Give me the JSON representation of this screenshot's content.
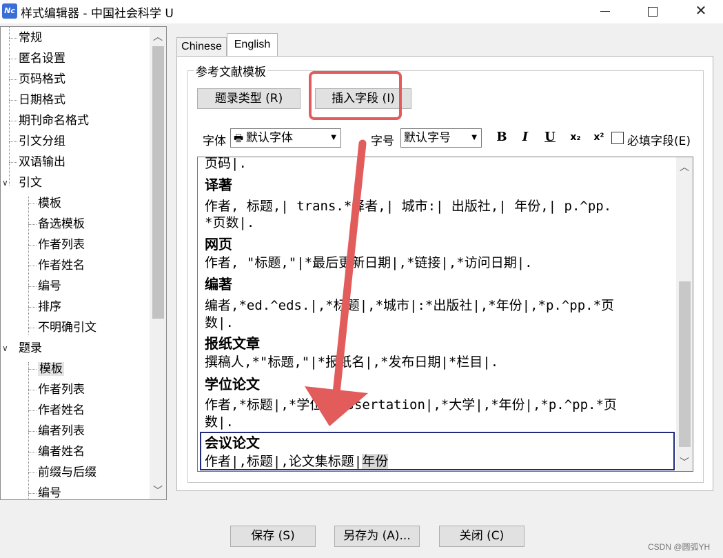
{
  "window": {
    "icon_text": "Nc",
    "title": "样式编辑器 - 中国社会科学 U",
    "minimize": "minimize",
    "maximize": "maximize",
    "close": "close"
  },
  "tree": {
    "items": [
      {
        "label": "常规"
      },
      {
        "label": "匿名设置"
      },
      {
        "label": "页码格式"
      },
      {
        "label": "日期格式"
      },
      {
        "label": "期刊命名格式"
      },
      {
        "label": "引文分组"
      },
      {
        "label": "双语输出"
      },
      {
        "label": "引文",
        "expander": "∨"
      },
      {
        "label": "模板"
      },
      {
        "label": "备选模板"
      },
      {
        "label": "作者列表"
      },
      {
        "label": "作者姓名"
      },
      {
        "label": "编号"
      },
      {
        "label": "排序"
      },
      {
        "label": "不明确引文"
      },
      {
        "label": "题录",
        "expander": "∨"
      },
      {
        "label": "模板",
        "selected": true
      },
      {
        "label": "作者列表"
      },
      {
        "label": "作者姓名"
      },
      {
        "label": "编者列表"
      },
      {
        "label": "编者姓名"
      },
      {
        "label": "前缀与后缀"
      },
      {
        "label": "编号"
      }
    ]
  },
  "tabs": [
    {
      "label": "Chinese",
      "active": false
    },
    {
      "label": "English",
      "active": true
    }
  ],
  "group": {
    "label": "参考文献模板",
    "btn_type": "题录类型 (R)",
    "btn_insert": "插入字段 (I)"
  },
  "toolbar": {
    "font_label": "字体",
    "font_value": "默认字体",
    "size_label": "字号",
    "size_value": "默认字号",
    "bold": "B",
    "italic": "I",
    "underline": "U",
    "subscript": "x₂",
    "superscript": "x²",
    "required_label": "必填字段(E)"
  },
  "editor": {
    "lines": [
      {
        "text": "页码|.",
        "head": false
      },
      {
        "text": "译著",
        "head": true
      },
      {
        "text": "作者, 标题,| trans.*译者,| 城市:| 出版社,| 年份,| p.^pp.",
        "head": false
      },
      {
        "text": "*页数|.",
        "head": false
      },
      {
        "text": "网页",
        "head": true
      },
      {
        "text": "作者, \"标题,\"|*最后更新日期|,*链接|,*访问日期|.",
        "head": false
      },
      {
        "text": "编著",
        "head": true
      },
      {
        "text": "编者,*ed.^eds.|,*标题|,*城市|:*出版社|,*年份|,*p.^pp.*页",
        "head": false
      },
      {
        "text": "数|.",
        "head": false
      },
      {
        "text": "报纸文章",
        "head": true
      },
      {
        "text": "撰稿人,*\"标题,\"|*报纸名|,*发布日期|*栏目|.",
        "head": false
      },
      {
        "text": "学位论文",
        "head": true
      },
      {
        "text": "作者,*标题|,*学位*dissertation|,*大学|,*年份|,*p.^pp.*页",
        "head": false
      },
      {
        "text": "数|.",
        "head": false
      },
      {
        "text": "会议论文",
        "head": true
      },
      {
        "text": "作者|,标题|,论文集标题|",
        "head": false,
        "selected_tail": "年份"
      }
    ]
  },
  "buttons": {
    "save": "保存 (S)",
    "save_as": "另存为 (A)...",
    "close": "关闭 (C)"
  },
  "watermark": "CSDN @圆弧YH",
  "colors": {
    "annotation_red": "#e25c5c",
    "active_border": "#1f2a7a"
  }
}
